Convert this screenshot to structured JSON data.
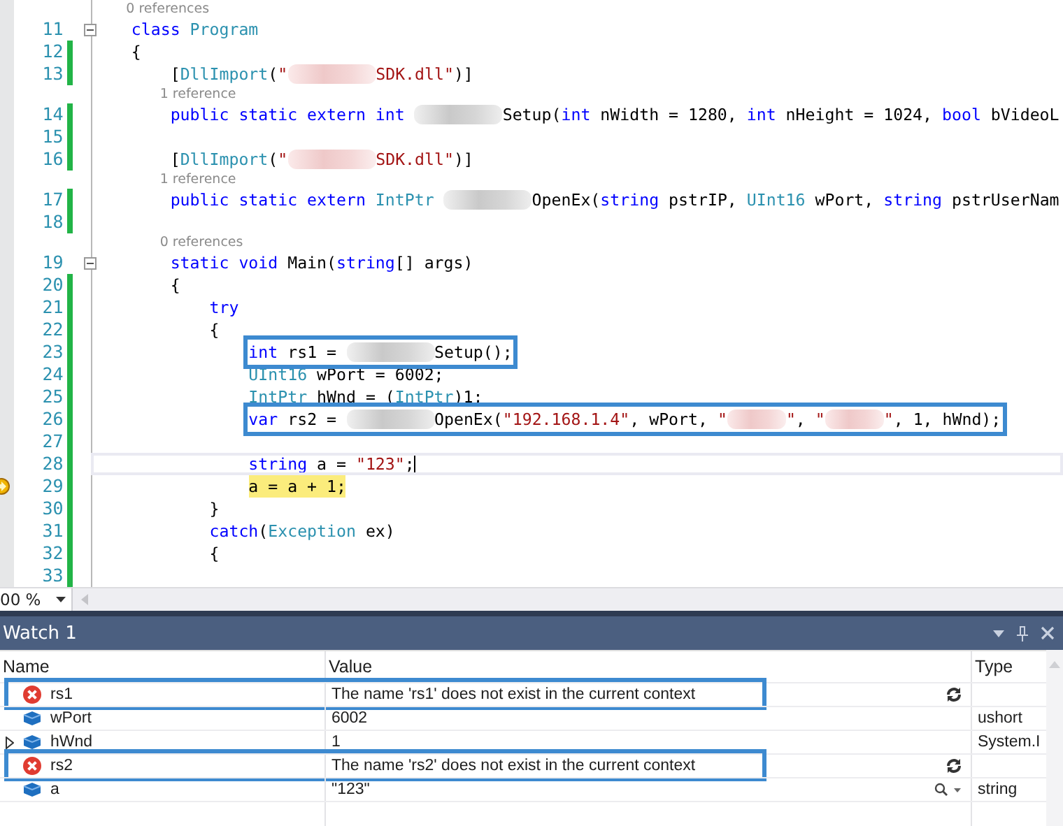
{
  "editor": {
    "lines": [
      {
        "kind": "lens",
        "text": "0 references"
      },
      {
        "kind": "code",
        "number": "11",
        "changed": false,
        "fold": true,
        "segments": [
          {
            "kind": "text",
            "tokens": [
              {
                "kind": "kw",
                "text": "    class "
              },
              {
                "kind": "type",
                "text": "Program"
              }
            ]
          }
        ]
      },
      {
        "kind": "code",
        "number": "12",
        "changed": true,
        "fold": false,
        "segments": [
          {
            "kind": "text",
            "tokens": [
              {
                "kind": "plain",
                "text": "    {"
              }
            ]
          }
        ]
      },
      {
        "kind": "code",
        "number": "13",
        "changed": true,
        "fold": false,
        "segments": [
          {
            "kind": "text",
            "tokens": [
              {
                "kind": "plain",
                "text": "        ["
              },
              {
                "kind": "type",
                "text": "DllImport"
              },
              {
                "kind": "plain",
                "text": "("
              },
              {
                "kind": "str",
                "text": "\""
              }
            ]
          },
          {
            "kind": "redacted_string"
          },
          {
            "kind": "text",
            "tokens": [
              {
                "kind": "str",
                "text": "SDK.dll\""
              },
              {
                "kind": "plain",
                "text": ")]"
              }
            ]
          }
        ]
      },
      {
        "kind": "lens",
        "text": "1 reference"
      },
      {
        "kind": "code",
        "number": "14",
        "changed": true,
        "fold": false,
        "segments": [
          {
            "kind": "text",
            "tokens": [
              {
                "kind": "kw",
                "text": "        public static extern int "
              }
            ]
          },
          {
            "kind": "redacted_name"
          },
          {
            "kind": "text",
            "tokens": [
              {
                "kind": "plain",
                "text": "Setup("
              },
              {
                "kind": "kw",
                "text": "int"
              },
              {
                "kind": "plain",
                "text": " nWidth = 1280, "
              },
              {
                "kind": "kw",
                "text": "int"
              },
              {
                "kind": "plain",
                "text": " nHeight = 1024, "
              },
              {
                "kind": "kw",
                "text": "bool"
              },
              {
                "kind": "plain",
                "text": " bVideoL"
              }
            ]
          }
        ]
      },
      {
        "kind": "code",
        "number": "15",
        "changed": true,
        "fold": false
      },
      {
        "kind": "code",
        "number": "16",
        "changed": true,
        "fold": false,
        "segments": [
          {
            "kind": "text",
            "tokens": [
              {
                "kind": "plain",
                "text": "        ["
              },
              {
                "kind": "type",
                "text": "DllImport"
              },
              {
                "kind": "plain",
                "text": "("
              },
              {
                "kind": "str",
                "text": "\""
              }
            ]
          },
          {
            "kind": "redacted_string"
          },
          {
            "kind": "text",
            "tokens": [
              {
                "kind": "str",
                "text": "SDK.dll\""
              },
              {
                "kind": "plain",
                "text": ")]"
              }
            ]
          }
        ]
      },
      {
        "kind": "lens",
        "text": "1 reference"
      },
      {
        "kind": "code",
        "number": "17",
        "changed": true,
        "fold": false,
        "segments": [
          {
            "kind": "text",
            "tokens": [
              {
                "kind": "kw",
                "text": "        public static extern "
              },
              {
                "kind": "type",
                "text": "IntPtr "
              }
            ]
          },
          {
            "kind": "redacted_name"
          },
          {
            "kind": "text",
            "tokens": [
              {
                "kind": "plain",
                "text": "OpenEx("
              },
              {
                "kind": "kw",
                "text": "string"
              },
              {
                "kind": "plain",
                "text": " pstrIP, "
              },
              {
                "kind": "type",
                "text": "UInt16"
              },
              {
                "kind": "plain",
                "text": " wPort, "
              },
              {
                "kind": "kw",
                "text": "string"
              },
              {
                "kind": "plain",
                "text": " pstrUserNam"
              }
            ]
          }
        ]
      },
      {
        "kind": "code",
        "number": "18",
        "changed": true,
        "fold": false
      },
      {
        "kind": "lens",
        "text": "0 references"
      },
      {
        "kind": "code",
        "number": "19",
        "changed": false,
        "fold": true,
        "segments": [
          {
            "kind": "text",
            "tokens": [
              {
                "kind": "kw",
                "text": "        static void"
              },
              {
                "kind": "plain",
                "text": " Main("
              },
              {
                "kind": "kw",
                "text": "string"
              },
              {
                "kind": "plain",
                "text": "[] args)"
              }
            ]
          }
        ]
      },
      {
        "kind": "code",
        "number": "20",
        "changed": true,
        "fold": false,
        "segments": [
          {
            "kind": "text",
            "tokens": [
              {
                "kind": "plain",
                "text": "        {"
              }
            ]
          }
        ]
      },
      {
        "kind": "code",
        "number": "21",
        "changed": true,
        "fold": false,
        "segments": [
          {
            "kind": "text",
            "tokens": [
              {
                "kind": "kw",
                "text": "            try"
              }
            ]
          }
        ]
      },
      {
        "kind": "code",
        "number": "22",
        "changed": true,
        "fold": false,
        "segments": [
          {
            "kind": "text",
            "tokens": [
              {
                "kind": "plain",
                "text": "            {"
              }
            ]
          }
        ]
      },
      {
        "kind": "code",
        "number": "23",
        "changed": true,
        "fold": false,
        "boxed": true,
        "segments": [
          {
            "kind": "text",
            "tokens": [
              {
                "kind": "kw",
                "text": "                int"
              },
              {
                "kind": "plain",
                "text": " rs1 = "
              }
            ]
          },
          {
            "kind": "redacted_name"
          },
          {
            "kind": "text",
            "tokens": [
              {
                "kind": "plain",
                "text": "Setup();"
              }
            ]
          }
        ]
      },
      {
        "kind": "code",
        "number": "24",
        "changed": true,
        "fold": false,
        "segments": [
          {
            "kind": "text",
            "tokens": [
              {
                "kind": "type",
                "text": "                UInt16"
              },
              {
                "kind": "plain",
                "text": " wPort = 6002;"
              }
            ]
          }
        ]
      },
      {
        "kind": "code",
        "number": "25",
        "changed": true,
        "fold": false,
        "segments": [
          {
            "kind": "text",
            "tokens": [
              {
                "kind": "type",
                "text": "                IntPtr"
              },
              {
                "kind": "plain",
                "text": " hWnd = ("
              },
              {
                "kind": "type",
                "text": "IntPtr"
              },
              {
                "kind": "plain",
                "text": ")1;"
              }
            ]
          }
        ]
      },
      {
        "kind": "code",
        "number": "26",
        "changed": true,
        "fold": false,
        "boxed": true,
        "segments": [
          {
            "kind": "text",
            "tokens": [
              {
                "kind": "kw",
                "text": "                var"
              },
              {
                "kind": "plain",
                "text": " rs2 = "
              }
            ]
          },
          {
            "kind": "redacted_name"
          },
          {
            "kind": "text",
            "tokens": [
              {
                "kind": "plain",
                "text": "OpenEx("
              },
              {
                "kind": "str",
                "text": "\"192.168.1.4\""
              },
              {
                "kind": "plain",
                "text": ", wPort, "
              },
              {
                "kind": "str",
                "text": "\""
              }
            ]
          },
          {
            "kind": "redacted_short"
          },
          {
            "kind": "text",
            "tokens": [
              {
                "kind": "str",
                "text": "\""
              },
              {
                "kind": "plain",
                "text": ", "
              },
              {
                "kind": "str",
                "text": "\""
              }
            ]
          },
          {
            "kind": "redacted_short"
          },
          {
            "kind": "text",
            "tokens": [
              {
                "kind": "str",
                "text": "\""
              },
              {
                "kind": "plain",
                "text": ", 1, hWnd);"
              }
            ]
          }
        ]
      },
      {
        "kind": "code",
        "number": "27",
        "changed": true,
        "fold": false
      },
      {
        "kind": "code",
        "number": "28",
        "changed": true,
        "fold": false,
        "cursor": true,
        "segments": [
          {
            "kind": "text",
            "tokens": [
              {
                "kind": "kw",
                "text": "                string"
              },
              {
                "kind": "plain",
                "text": " a = "
              },
              {
                "kind": "str",
                "text": "\"123\""
              },
              {
                "kind": "plain",
                "text": ";"
              }
            ]
          }
        ]
      },
      {
        "kind": "code",
        "number": "29",
        "changed": true,
        "fold": false,
        "current": true,
        "segments": [
          {
            "kind": "text",
            "tokens": [
              {
                "kind": "plain",
                "text": "                a = a + 1;"
              }
            ]
          }
        ]
      },
      {
        "kind": "code",
        "number": "30",
        "changed": true,
        "fold": false,
        "segments": [
          {
            "kind": "text",
            "tokens": [
              {
                "kind": "plain",
                "text": "            }"
              }
            ]
          }
        ]
      },
      {
        "kind": "code",
        "number": "31",
        "changed": true,
        "fold": false,
        "segments": [
          {
            "kind": "text",
            "tokens": [
              {
                "kind": "kw",
                "text": "            catch"
              },
              {
                "kind": "plain",
                "text": "("
              },
              {
                "kind": "type",
                "text": "Exception"
              },
              {
                "kind": "plain",
                "text": " ex)"
              }
            ]
          }
        ]
      },
      {
        "kind": "code",
        "number": "32",
        "changed": true,
        "fold": false,
        "segments": [
          {
            "kind": "text",
            "tokens": [
              {
                "kind": "plain",
                "text": "            {"
              }
            ]
          }
        ]
      },
      {
        "kind": "code",
        "number": "33",
        "changed": true,
        "fold": false
      }
    ],
    "zoom": "00 %"
  },
  "watch": {
    "title": "Watch 1",
    "columns": [
      "Name",
      "Value",
      "Type"
    ],
    "rows": [
      {
        "name": "rs1",
        "kind": "error",
        "expandable": false,
        "boxed": true,
        "value": "The name 'rs1' does not exist in the current context",
        "visualizer": false
      },
      {
        "name": "wPort",
        "kind": "variable",
        "expandable": false,
        "boxed": false,
        "value": "6002",
        "visualizer": false,
        "type": "ushort"
      },
      {
        "name": "hWnd",
        "kind": "variable",
        "expandable": true,
        "boxed": false,
        "value": "1",
        "visualizer": false,
        "type": "System.I"
      },
      {
        "name": "rs2",
        "kind": "error",
        "expandable": false,
        "boxed": true,
        "value": "The name 'rs2' does not exist in the current context",
        "visualizer": false
      },
      {
        "name": "a",
        "kind": "variable",
        "expandable": false,
        "boxed": false,
        "value": "\"123\"",
        "visualizer": true,
        "type": "string"
      }
    ]
  }
}
